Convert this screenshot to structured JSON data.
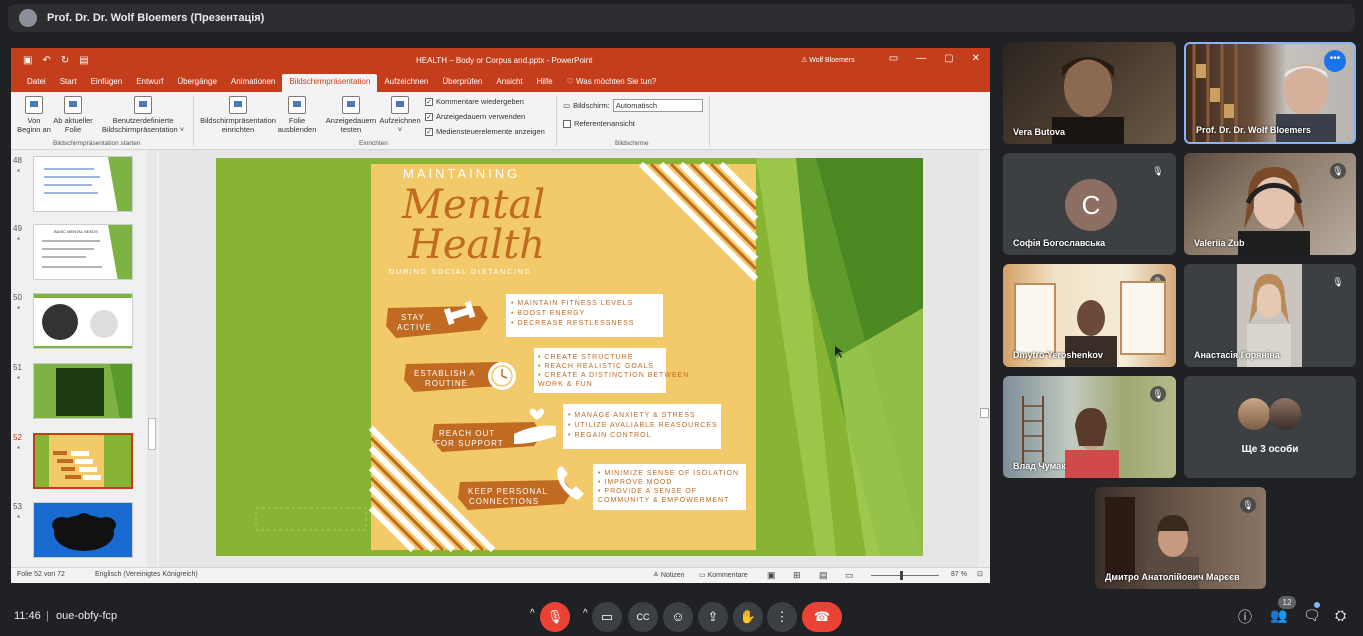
{
  "presenter": {
    "title": "Prof. Dr. Dr. Wolf Bloemers (Презентація)"
  },
  "ppt": {
    "title": "HEALTH – Body or Corpus and.pptx - PowerPoint",
    "user": "Wolf Bloemers",
    "tabs": [
      "Datei",
      "Start",
      "Einfügen",
      "Entwurf",
      "Übergänge",
      "Animationen",
      "Bildschirmpräsentation",
      "Aufzeichnen",
      "Überprüfen",
      "Ansicht",
      "Hilfe",
      "Was möchten Sie tun?"
    ],
    "ribbon": {
      "von_beginn": "Von Beginn an",
      "ab_aktueller": "Ab aktueller Folie",
      "benutzerdef": "Benutzerdefinierte Bildschirmpräsentation",
      "group1": "Bildschirmpräsentation starten",
      "einrichten": "Bildschirmpräsentation einrichten",
      "folie_aus": "Folie ausblenden",
      "probelauf": "Anzeigedauern testen",
      "aufzeichnen": "Aufzeichnen",
      "cb1": "Kommentare wiedergeben",
      "cb2": "Anzeigedauern verwenden",
      "cb3": "Mediensteuerelemente anzeigen",
      "group2": "Einrichten",
      "bildschirm_label": "Bildschirm:",
      "bildschirm_value": "Automatisch",
      "referentenansicht": "Referentenansicht",
      "group3": "Bildschirme"
    },
    "thumbs": [
      {
        "num": "48",
        "star": "*"
      },
      {
        "num": "49",
        "star": "*",
        "heading": "BASIC MENTAL NEEDS"
      },
      {
        "num": "50",
        "star": "*"
      },
      {
        "num": "51",
        "star": "*"
      },
      {
        "num": "52",
        "star": "*"
      },
      {
        "num": "53",
        "star": "*"
      }
    ],
    "slide": {
      "maintaining": "MAINTAINING",
      "mental": "Mental",
      "health": "Health",
      "during": "DURING SOCIAL DISTANCING",
      "items": [
        {
          "label1": "STAY",
          "label2": "ACTIVE",
          "bullets": [
            "• MAINTAIN FITNESS LEVELS",
            "• BOOST ENERGY",
            "• DECREASE RESTLESSNESS"
          ]
        },
        {
          "label1": "ESTABLISH A",
          "label2": "ROUTINE",
          "bullets": [
            "• CREATE STRUCTURE",
            "• REACH REALISTIC GOALS",
            "• CREATE A DISTINCTION BETWEEN",
            "   WORK & FUN"
          ]
        },
        {
          "label1": "REACH OUT",
          "label2": "FOR SUPPORT",
          "bullets": [
            "• MANAGE ANXIETY & STRESS",
            "• UTILIZE AVALIABLE REASOURCES",
            "• REGAIN CONTROL"
          ]
        },
        {
          "label1": "KEEP PERSONAL",
          "label2": "CONNECTIONS",
          "bullets": [
            "• MINIMIZE SENSE OF ISOLATION",
            "• IMPROVE MOOD",
            "• PROVIDE A SENSE OF",
            "   COMMUNITY & EMPOWERMENT"
          ]
        }
      ]
    },
    "status": {
      "slide": "Folie 52 von 72",
      "lang": "Englisch (Vereinigtes Königreich)",
      "notes": "Notizen",
      "comments": "Kommentare",
      "zoom": "87 %"
    }
  },
  "participants": [
    {
      "name": "Vera Butova"
    },
    {
      "name": "Prof. Dr. Dr. Wolf Bloemers"
    },
    {
      "name": "Софія Богославська",
      "initial": "C"
    },
    {
      "name": "Valeriia Zub"
    },
    {
      "name": "Dmytro Yeroshenkov"
    },
    {
      "name": "Анастасія Горяніна"
    },
    {
      "name": "Влад Чумак"
    },
    {
      "name": "Ще 3 особи"
    },
    {
      "name": "Дмитро Анатолійович Марєєв"
    }
  ],
  "bottom": {
    "time": "11:46",
    "meeting": "oue-obfy-fcp",
    "people_count": "12"
  },
  "colors": {
    "ppt_red": "#c43e1c",
    "slide_green": "#87b533",
    "slide_yellow": "#f2ca6a",
    "slide_brown": "#c06a22",
    "leave_red": "#ea4335"
  }
}
